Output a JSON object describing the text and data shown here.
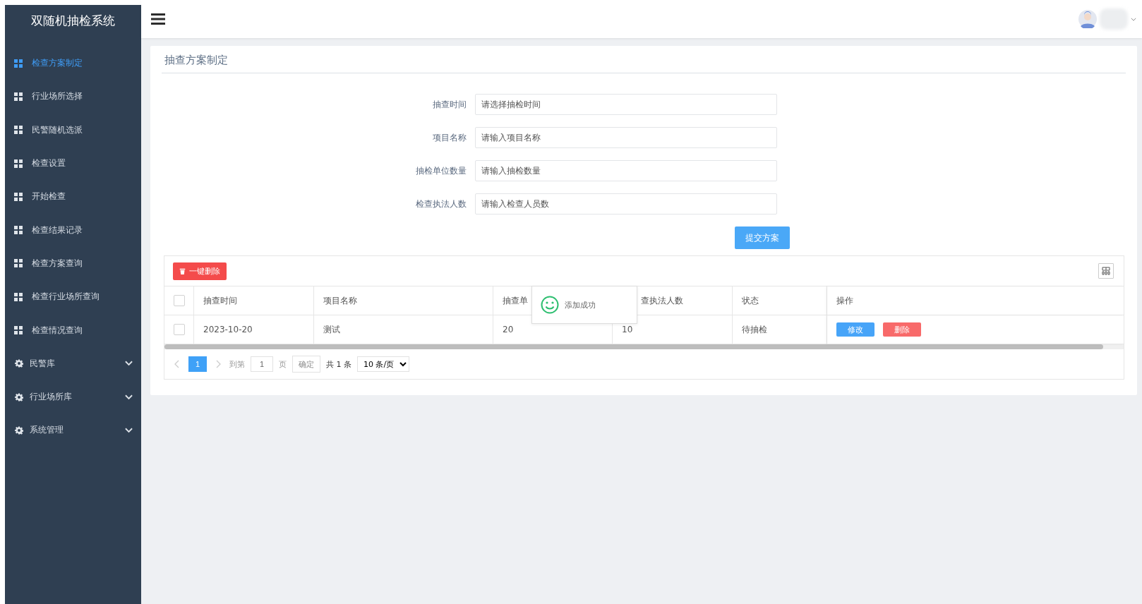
{
  "sidebar": {
    "title": "双随机抽检系统",
    "items": [
      {
        "label": "检查方案制定",
        "kind": "page",
        "selected": true
      },
      {
        "label": "行业场所选择",
        "kind": "page",
        "selected": false
      },
      {
        "label": "民警随机选派",
        "kind": "page",
        "selected": false
      },
      {
        "label": "检查设置",
        "kind": "page",
        "selected": false
      },
      {
        "label": "开始检查",
        "kind": "page",
        "selected": false
      },
      {
        "label": "检查结果记录",
        "kind": "page",
        "selected": false
      },
      {
        "label": "检查方案查询",
        "kind": "page",
        "selected": false
      },
      {
        "label": "检查行业场所查询",
        "kind": "page",
        "selected": false
      },
      {
        "label": "检查情况查询",
        "kind": "page",
        "selected": false
      },
      {
        "label": "民警库",
        "kind": "group",
        "selected": false,
        "expanded": false
      },
      {
        "label": "行业场所库",
        "kind": "group",
        "selected": false,
        "expanded": false
      },
      {
        "label": "系统管理",
        "kind": "group",
        "selected": false,
        "expanded": false
      }
    ]
  },
  "panel": {
    "title": "抽查方案制定",
    "fields": [
      {
        "label": "抽查时间",
        "placeholder": "请选择抽检时间"
      },
      {
        "label": "项目名称",
        "placeholder": "请输入项目名称"
      },
      {
        "label": "抽检单位数量",
        "placeholder": "请输入抽检数量"
      },
      {
        "label": "检查执法人数",
        "placeholder": "请输入检查人员数"
      }
    ],
    "submit": "提交方案"
  },
  "table": {
    "delete_all": "一键删除",
    "columns": [
      "抽查时间",
      "项目名称",
      "抽查单",
      "查执法人数",
      "状态",
      "操作"
    ],
    "rows": [
      {
        "checked": false,
        "cells": [
          "2023-10-20",
          "测试",
          "20",
          "10",
          "待抽检"
        ],
        "actions": [
          "修改",
          "删除"
        ]
      }
    ],
    "header_checked": false
  },
  "pagination": {
    "pages": [
      {
        "label": "1",
        "selected": true
      }
    ],
    "goto_label": "到第",
    "goto_value": "1",
    "page_unit": "页",
    "confirm": "确定",
    "total": "共 1 条",
    "page_size": "10 条/页"
  },
  "toast": {
    "message": "添加成功"
  }
}
